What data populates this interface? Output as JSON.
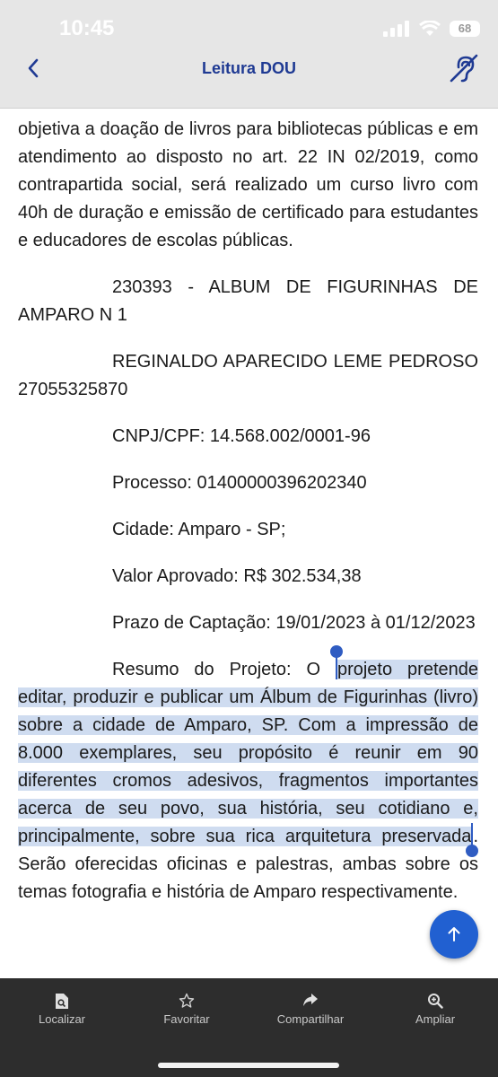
{
  "status": {
    "time": "10:45",
    "battery": "68"
  },
  "header": {
    "title": "Leitura DOU"
  },
  "content": {
    "p1": "objetiva a doação de livros para bibliotecas públicas e em atendimento ao disposto no art. 22 IN 02/2019, como contrapartida social, será realizado um curso livro com 40h de duração e emissão de certificado para estudantes e educadores de escolas públicas.",
    "p2": "230393 - ALBUM DE FIGURINHAS DE AMPARO N 1",
    "p3": "REGINALDO APARECIDO LEME PEDROSO 27055325870",
    "p4": "CNPJ/CPF: 14.568.002/0001-96",
    "p5": "Processo: 01400000396202340",
    "p6": "Cidade: Amparo - SP;",
    "p7": "Valor Aprovado: R$ 302.534,38",
    "p8": "Prazo de Captação: 19/01/2023 à 01/12/2023",
    "p9_before": "Resumo do Projeto: O ",
    "p9_selected": "projeto pretende editar, produzir e publicar um Álbum de Figurinhas (livro) sobre a cidade de Amparo, SP. Com a impressão de 8.000 exemplares, seu propósito é reunir em 90 diferentes cromos adesivos, fragmentos importantes acerca de seu povo, sua história, seu cotidiano e, principalmente, sobre sua rica arquitetura preservada",
    "p9_after": ". Serão oferecidas oficinas e palestras, ambas sobre os temas fotografia e história de Amparo respectivamente."
  },
  "toolbar": {
    "find": "Localizar",
    "favorite": "Favoritar",
    "share": "Compartilhar",
    "zoom": "Ampliar"
  },
  "icons": {
    "back": "chevron-left-icon",
    "accessibility": "hearing-accessibility-icon",
    "scroll_top": "arrow-up-icon",
    "find": "document-search-icon",
    "favorite": "star-icon",
    "share": "share-arrow-icon",
    "zoom": "zoom-in-icon"
  },
  "colors": {
    "accent": "#1f3a93",
    "fab": "#2160d1",
    "selection": "#cfdcf0",
    "toolbar_bg": "#2d2d2d"
  }
}
